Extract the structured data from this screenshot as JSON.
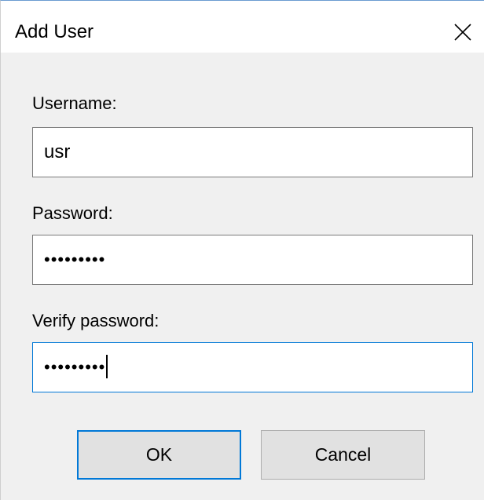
{
  "window": {
    "title": "Add User",
    "close_icon": "close-icon"
  },
  "form": {
    "username": {
      "label": "Username:",
      "value": "usr"
    },
    "password": {
      "label": "Password:",
      "value": "•••••••••"
    },
    "verify_password": {
      "label": "Verify password:",
      "value": "•••••••••"
    }
  },
  "buttons": {
    "ok_label": "OK",
    "cancel_label": "Cancel"
  },
  "colors": {
    "focus_accent": "#0078d7",
    "dialog_background": "#f0f0f0",
    "button_background": "#e1e1e1"
  }
}
